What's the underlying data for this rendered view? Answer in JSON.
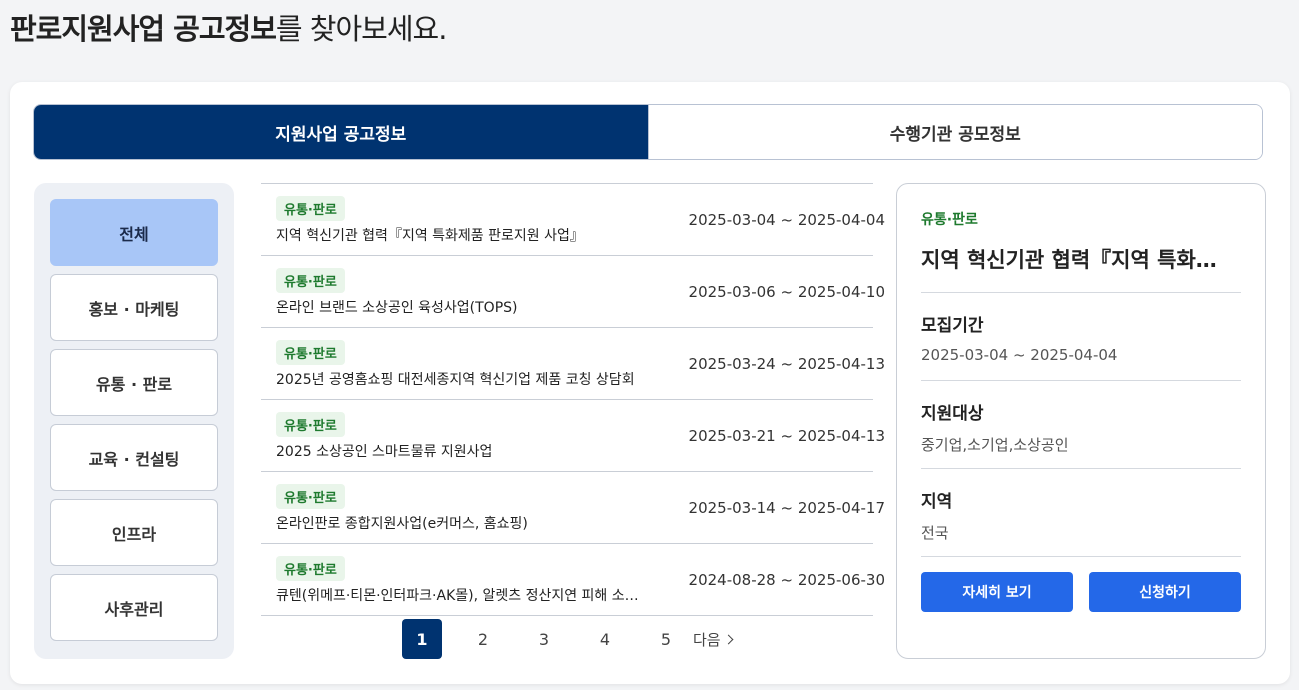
{
  "headline": {
    "strong": "판로지원사업 공고정보",
    "rest": "를 찾아보세요."
  },
  "tabs": [
    {
      "label": "지원사업 공고정보",
      "active": true
    },
    {
      "label": "수행기관 공모정보",
      "active": false
    }
  ],
  "categories": [
    {
      "label": "전체",
      "active": true
    },
    {
      "label": "홍보 · 마케팅",
      "active": false
    },
    {
      "label": "유통 · 판로",
      "active": false
    },
    {
      "label": "교육 · 컨설팅",
      "active": false
    },
    {
      "label": "인프라",
      "active": false
    },
    {
      "label": "사후관리",
      "active": false
    }
  ],
  "announcements": [
    {
      "badge": "유통·판로",
      "title": "지역 혁신기관 협력『지역 특화제품 판로지원 사업』",
      "period": "2025-03-04 ~ 2025-04-04"
    },
    {
      "badge": "유통·판로",
      "title": "온라인 브랜드 소상공인 육성사업(TOPS)",
      "period": "2025-03-06 ~ 2025-04-10"
    },
    {
      "badge": "유통·판로",
      "title": "2025년 공영홈쇼핑 대전세종지역 혁신기업 제품 코칭 상담회",
      "period": "2025-03-24 ~ 2025-04-13"
    },
    {
      "badge": "유통·판로",
      "title": "2025 소상공인 스마트물류 지원사업",
      "period": "2025-03-21 ~ 2025-04-13"
    },
    {
      "badge": "유통·판로",
      "title": "온라인판로 종합지원사업(e커머스, 홈쇼핑)",
      "period": "2025-03-14 ~ 2025-04-17"
    },
    {
      "badge": "유통·판로",
      "title": "큐텐(위메프·티몬·인터파크·AK몰), 알렛츠 정산지연 피해 소…",
      "period": "2024-08-28 ~ 2025-06-30"
    }
  ],
  "pagination": {
    "pages": [
      "1",
      "2",
      "3",
      "4",
      "5"
    ],
    "current": "1",
    "next_label": "다음"
  },
  "detail": {
    "badge": "유통·판로",
    "title": "지역 혁신기관 협력『지역 특화제품 판로지원 사업』",
    "period_label": "모집기간",
    "period_value": "2025-03-04 ~ 2025-04-04",
    "target_label": "지원대상",
    "target_value": "중기업,소기업,소상공인",
    "region_label": "지역",
    "region_value": "전국",
    "detail_button": "자세히 보기",
    "apply_button": "신청하기"
  }
}
